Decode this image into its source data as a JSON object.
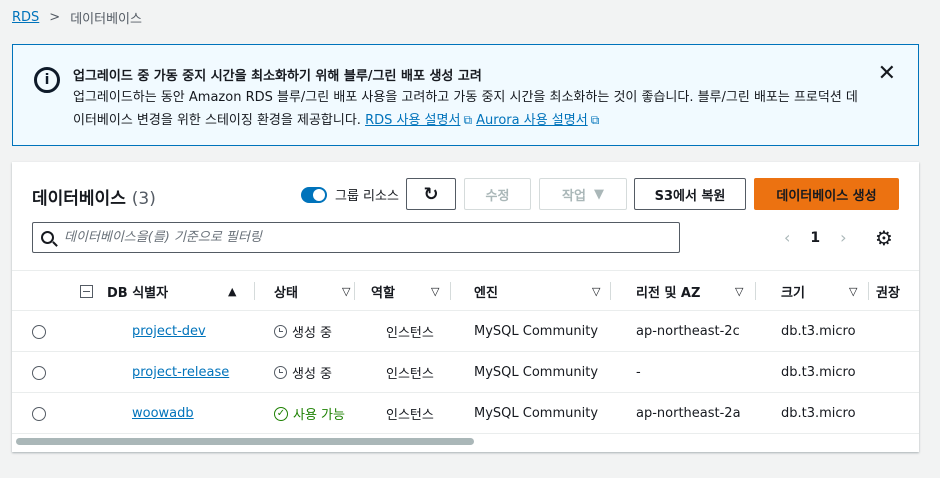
{
  "breadcrumb": {
    "root": "RDS",
    "current": "데이터베이스"
  },
  "alert": {
    "title": "업그레이드 중 가동 중지 시간을 최소화하기 위해 블루/그린 배포 생성 고려",
    "body_line1": "업그레이드하는 동안 Amazon RDS 블루/그린 배포 사용을 고려하고 가동 중지 시간을 최소화하는 것이 좋습니다. 블루/그린 배포는 프로덕션 데",
    "body_line2": "이터베이스 변경을 위한 스테이징 환경을 제공합니다.",
    "link1": "RDS 사용 설명서",
    "link2": "Aurora 사용 설명서"
  },
  "panel": {
    "title": "데이터베이스",
    "count": "(3)",
    "group_label": "그룹 리소스",
    "buttons": {
      "edit": "수정",
      "action": "작업",
      "restore_s3": "S3에서 복원",
      "create": "데이터베이스 생성"
    },
    "search_placeholder": "데이터베이스을(를) 기준으로 필터링",
    "page": "1"
  },
  "columns": [
    "DB 식별자",
    "상태",
    "역할",
    "엔진",
    "리전 및 AZ",
    "크기",
    "권장"
  ],
  "rows": [
    {
      "id": "project-dev",
      "status": "생성 중",
      "role": "인스턴스",
      "engine": "MySQL Community",
      "region": "ap-northeast-2c",
      "size": "db.t3.micro"
    },
    {
      "id": "project-release",
      "status": "생성 중",
      "role": "인스턴스",
      "engine": "MySQL Community",
      "region": "-",
      "size": "db.t3.micro"
    },
    {
      "id": "woowadb",
      "status": "사용 가능",
      "role": "인스턴스",
      "engine": "MySQL Community",
      "region": "ap-northeast-2a",
      "size": "db.t3.micro"
    }
  ],
  "colors": {
    "link": "#0073bb",
    "primary": "#ec7211",
    "available": "#1d8102"
  },
  "icons": [
    "info-icon",
    "close-icon",
    "refresh-icon",
    "caret-down-icon",
    "search-icon",
    "chevron-left-icon",
    "chevron-right-icon",
    "gear-icon",
    "clock-icon",
    "check-circle-icon",
    "external-link-icon"
  ]
}
